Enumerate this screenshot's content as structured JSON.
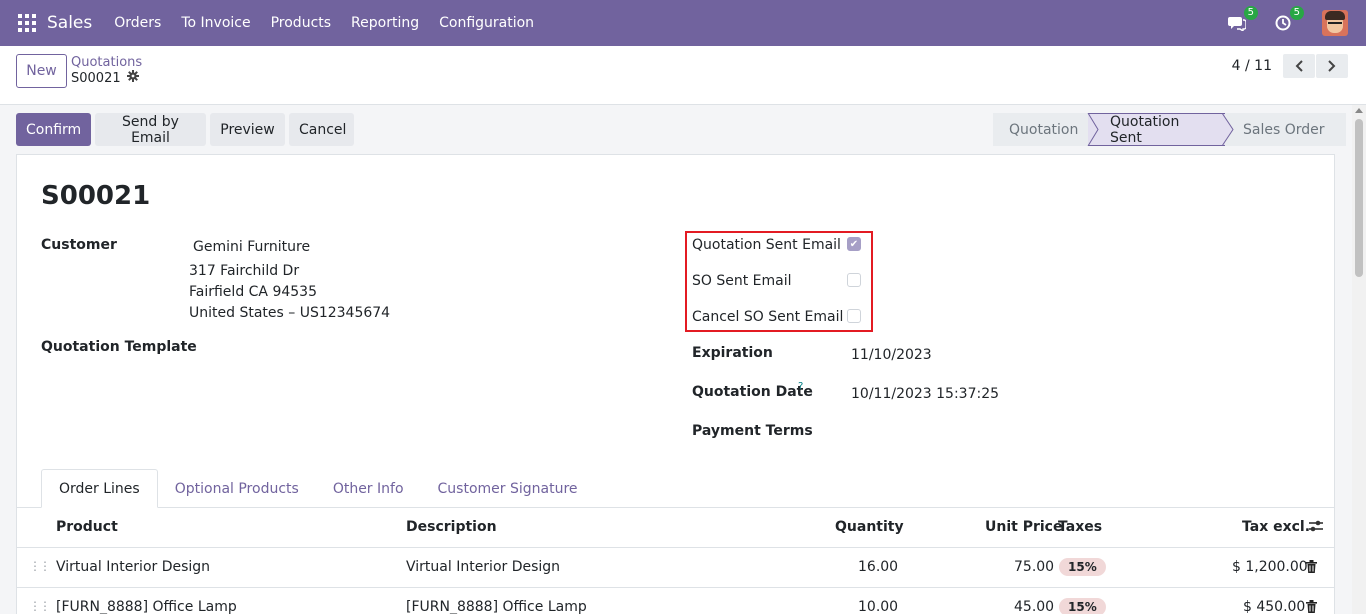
{
  "nav": {
    "brand": "Sales",
    "menu": [
      "Orders",
      "To Invoice",
      "Products",
      "Reporting",
      "Configuration"
    ],
    "chat_count": "5",
    "activity_count": "5"
  },
  "control": {
    "new_label": "New",
    "breadcrumb_parent": "Quotations",
    "breadcrumb_current": "S00021",
    "pager_value": "4 / 11"
  },
  "actions": {
    "confirm": "Confirm",
    "send_email": "Send by Email",
    "preview": "Preview",
    "cancel": "Cancel"
  },
  "status": {
    "stages": [
      "Quotation",
      "Quotation Sent",
      "Sales Order"
    ],
    "active": "Quotation Sent"
  },
  "form": {
    "title": "S00021",
    "customer_label": "Customer",
    "customer_name": "Gemini Furniture",
    "address": [
      "317 Fairchild Dr",
      "Fairfield CA 94535",
      "United States – US12345674"
    ],
    "template_label": "Quotation Template",
    "checkboxes": [
      {
        "label": "Quotation Sent Email",
        "checked": true
      },
      {
        "label": "SO Sent Email",
        "checked": false
      },
      {
        "label": "Cancel SO Sent Email",
        "checked": false
      }
    ],
    "expiration_label": "Expiration",
    "expiration_value": "11/10/2023",
    "quotation_date_label": "Quotation Date",
    "quotation_date_help": "?",
    "quotation_date_value": "10/11/2023 15:37:25",
    "payment_terms_label": "Payment Terms"
  },
  "tabs": [
    "Order Lines",
    "Optional Products",
    "Other Info",
    "Customer Signature"
  ],
  "table": {
    "headers": [
      "Product",
      "Description",
      "Quantity",
      "Unit Price",
      "Taxes",
      "Tax excl."
    ],
    "rows": [
      {
        "product": "Virtual Interior Design",
        "description": "Virtual Interior Design",
        "quantity": "16.00",
        "unit_price": "75.00",
        "tax": "15%",
        "subtotal": "$ 1,200.00"
      },
      {
        "product": "[FURN_8888] Office Lamp",
        "description": "[FURN_8888] Office Lamp",
        "quantity": "10.00",
        "unit_price": "45.00",
        "tax": "15%",
        "subtotal": "$ 450.00"
      }
    ]
  },
  "colors": {
    "brand": "#71639e",
    "highlight": "#e31b23",
    "badge": "#28a745"
  }
}
